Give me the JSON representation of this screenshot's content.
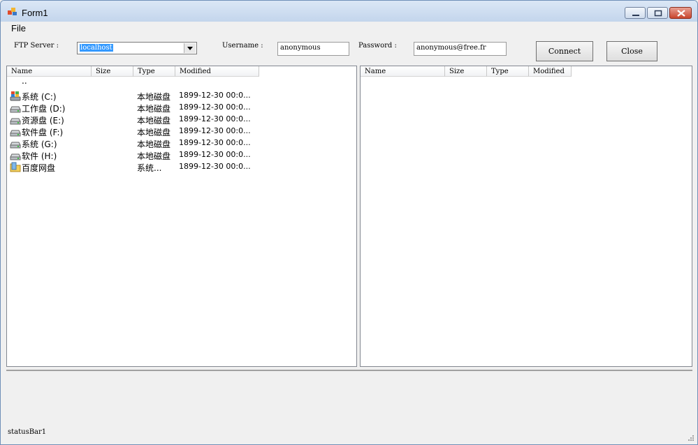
{
  "window": {
    "title": "Form1"
  },
  "menu": {
    "file": "File"
  },
  "form": {
    "ftp_label": "FTP Server :",
    "ftp_value": "localhost",
    "username_label": "Username :",
    "username_value": "anonymous",
    "password_label": "Password :",
    "password_value": "anonymous@free.fr",
    "connect_label": "Connect",
    "close_label": "Close"
  },
  "columns": [
    "Name",
    "Size",
    "Type",
    "Modified"
  ],
  "left_list": {
    "parent": "..",
    "rows": [
      {
        "name": "系统 (C:)",
        "type": "本地磁盘",
        "modified": "1899-12-30 00:0...",
        "icon": "system-drive-icon"
      },
      {
        "name": "工作盘 (D:)",
        "type": "本地磁盘",
        "modified": "1899-12-30 00:0...",
        "icon": "drive-icon"
      },
      {
        "name": "资源盘 (E:)",
        "type": "本地磁盘",
        "modified": "1899-12-30 00:0...",
        "icon": "drive-icon"
      },
      {
        "name": "软件盘 (F:)",
        "type": "本地磁盘",
        "modified": "1899-12-30 00:0...",
        "icon": "drive-icon"
      },
      {
        "name": "系统 (G:)",
        "type": "本地磁盘",
        "modified": "1899-12-30 00:0...",
        "icon": "drive-icon"
      },
      {
        "name": "软件 (H:)",
        "type": "本地磁盘",
        "modified": "1899-12-30 00:0...",
        "icon": "drive-icon"
      },
      {
        "name": "百度网盘",
        "type": "系统...",
        "modified": "1899-12-30 00:0...",
        "icon": "folder-icon"
      }
    ]
  },
  "status": {
    "text": "statusBar1"
  },
  "colors": {
    "selection": "#3399ff",
    "title_gradient_top": "#dbe7f6",
    "close_button": "#c9452d"
  }
}
